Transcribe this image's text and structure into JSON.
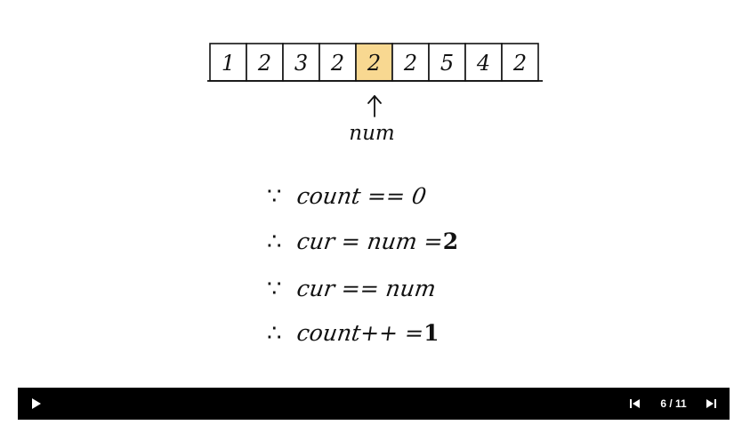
{
  "diagram": {
    "array_values": [
      "1",
      "2",
      "3",
      "2",
      "2",
      "2",
      "5",
      "4",
      "2"
    ],
    "highlighted_index": 4,
    "pointer_label": "num",
    "highlight_color": "#f8d891",
    "ink_color": "#111111"
  },
  "notes": {
    "lines": [
      {
        "symbol": "∵",
        "text": "count == 0",
        "result": ""
      },
      {
        "symbol": "∴",
        "text": "cur = num  = ",
        "result": "2"
      },
      {
        "symbol": "∵",
        "text": "cur == num",
        "result": ""
      },
      {
        "symbol": "∴",
        "text": "count++    = ",
        "result": "1"
      }
    ]
  },
  "player": {
    "play_icon": "play-icon",
    "previous_icon": "skip-previous-icon",
    "next_icon": "skip-next-icon",
    "page_counter": "6 / 11",
    "background": "#000000",
    "foreground": "#ffffff"
  }
}
